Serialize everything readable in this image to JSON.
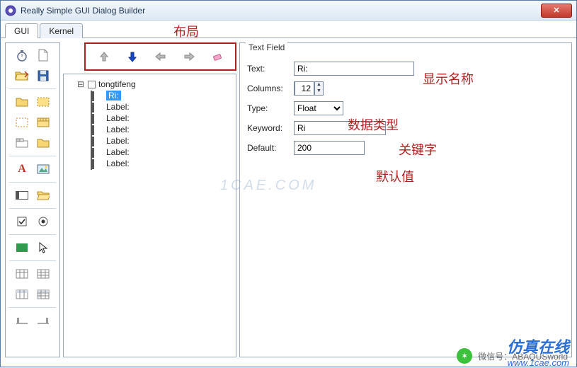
{
  "window": {
    "title": "Really Simple GUI Dialog Builder"
  },
  "tabs": {
    "gui": "GUI",
    "kernel": "Kernel"
  },
  "tree": {
    "root": "tongtifeng",
    "items": [
      "Ri:",
      "Label:",
      "Label:",
      "Label:",
      "Label:",
      "Label:",
      "Label:"
    ]
  },
  "props": {
    "legend": "Text Field",
    "text_label": "Text:",
    "text_value": "Ri:",
    "columns_label": "Columns:",
    "columns_value": "12",
    "type_label": "Type:",
    "type_value": "Float",
    "keyword_label": "Keyword:",
    "keyword_value": "Ri",
    "default_label": "Default:",
    "default_value": "200"
  },
  "annotations": {
    "layout": "布局",
    "display_name": "显示名称",
    "data_type": "数据类型",
    "keyword": "关键字",
    "default_value": "默认值"
  },
  "footer": {
    "wechat_label": "微信号：ABAQUSworld",
    "brand1": "仿真在线",
    "brand2": "www.1cae.com"
  },
  "watermark": "1CAE.COM",
  "colors": {
    "accent_red": "#b02020",
    "arrow_blue": "#1948c9"
  }
}
